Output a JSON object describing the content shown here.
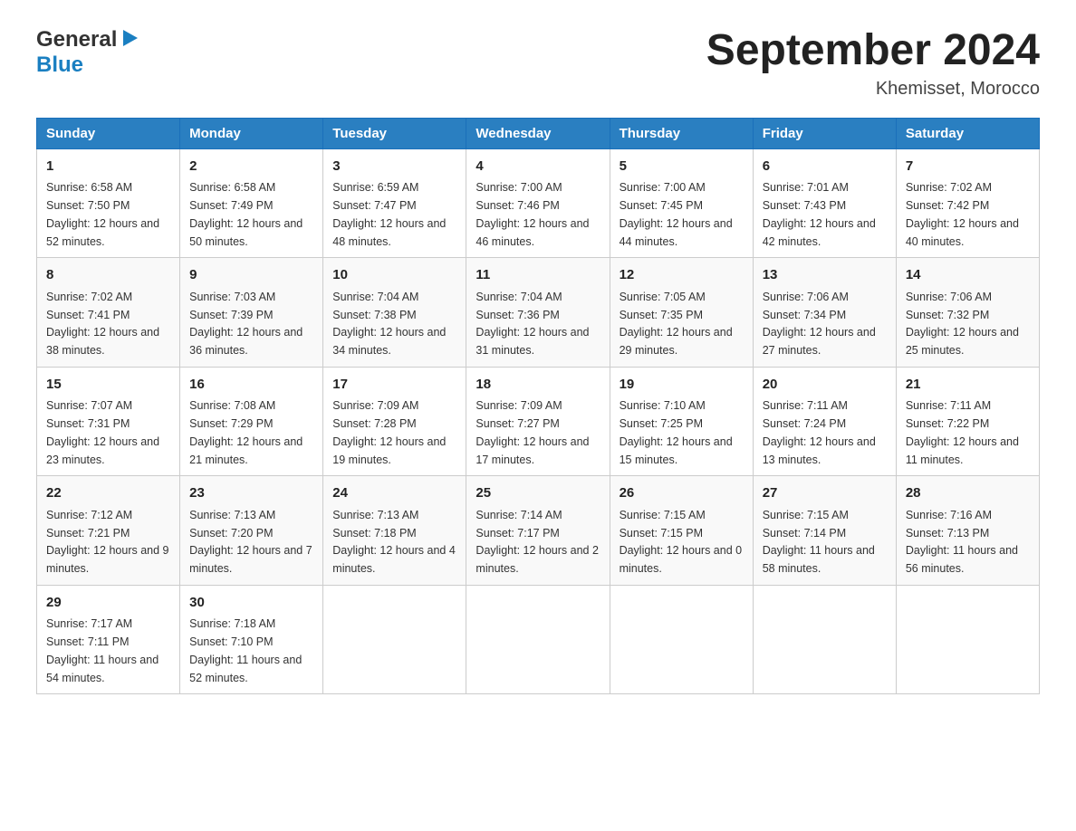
{
  "header": {
    "logo_general": "General",
    "logo_blue": "Blue",
    "month_year": "September 2024",
    "location": "Khemisset, Morocco"
  },
  "days_of_week": [
    "Sunday",
    "Monday",
    "Tuesday",
    "Wednesday",
    "Thursday",
    "Friday",
    "Saturday"
  ],
  "weeks": [
    [
      {
        "day": "1",
        "sunrise": "6:58 AM",
        "sunset": "7:50 PM",
        "daylight": "12 hours and 52 minutes."
      },
      {
        "day": "2",
        "sunrise": "6:58 AM",
        "sunset": "7:49 PM",
        "daylight": "12 hours and 50 minutes."
      },
      {
        "day": "3",
        "sunrise": "6:59 AM",
        "sunset": "7:47 PM",
        "daylight": "12 hours and 48 minutes."
      },
      {
        "day": "4",
        "sunrise": "7:00 AM",
        "sunset": "7:46 PM",
        "daylight": "12 hours and 46 minutes."
      },
      {
        "day": "5",
        "sunrise": "7:00 AM",
        "sunset": "7:45 PM",
        "daylight": "12 hours and 44 minutes."
      },
      {
        "day": "6",
        "sunrise": "7:01 AM",
        "sunset": "7:43 PM",
        "daylight": "12 hours and 42 minutes."
      },
      {
        "day": "7",
        "sunrise": "7:02 AM",
        "sunset": "7:42 PM",
        "daylight": "12 hours and 40 minutes."
      }
    ],
    [
      {
        "day": "8",
        "sunrise": "7:02 AM",
        "sunset": "7:41 PM",
        "daylight": "12 hours and 38 minutes."
      },
      {
        "day": "9",
        "sunrise": "7:03 AM",
        "sunset": "7:39 PM",
        "daylight": "12 hours and 36 minutes."
      },
      {
        "day": "10",
        "sunrise": "7:04 AM",
        "sunset": "7:38 PM",
        "daylight": "12 hours and 34 minutes."
      },
      {
        "day": "11",
        "sunrise": "7:04 AM",
        "sunset": "7:36 PM",
        "daylight": "12 hours and 31 minutes."
      },
      {
        "day": "12",
        "sunrise": "7:05 AM",
        "sunset": "7:35 PM",
        "daylight": "12 hours and 29 minutes."
      },
      {
        "day": "13",
        "sunrise": "7:06 AM",
        "sunset": "7:34 PM",
        "daylight": "12 hours and 27 minutes."
      },
      {
        "day": "14",
        "sunrise": "7:06 AM",
        "sunset": "7:32 PM",
        "daylight": "12 hours and 25 minutes."
      }
    ],
    [
      {
        "day": "15",
        "sunrise": "7:07 AM",
        "sunset": "7:31 PM",
        "daylight": "12 hours and 23 minutes."
      },
      {
        "day": "16",
        "sunrise": "7:08 AM",
        "sunset": "7:29 PM",
        "daylight": "12 hours and 21 minutes."
      },
      {
        "day": "17",
        "sunrise": "7:09 AM",
        "sunset": "7:28 PM",
        "daylight": "12 hours and 19 minutes."
      },
      {
        "day": "18",
        "sunrise": "7:09 AM",
        "sunset": "7:27 PM",
        "daylight": "12 hours and 17 minutes."
      },
      {
        "day": "19",
        "sunrise": "7:10 AM",
        "sunset": "7:25 PM",
        "daylight": "12 hours and 15 minutes."
      },
      {
        "day": "20",
        "sunrise": "7:11 AM",
        "sunset": "7:24 PM",
        "daylight": "12 hours and 13 minutes."
      },
      {
        "day": "21",
        "sunrise": "7:11 AM",
        "sunset": "7:22 PM",
        "daylight": "12 hours and 11 minutes."
      }
    ],
    [
      {
        "day": "22",
        "sunrise": "7:12 AM",
        "sunset": "7:21 PM",
        "daylight": "12 hours and 9 minutes."
      },
      {
        "day": "23",
        "sunrise": "7:13 AM",
        "sunset": "7:20 PM",
        "daylight": "12 hours and 7 minutes."
      },
      {
        "day": "24",
        "sunrise": "7:13 AM",
        "sunset": "7:18 PM",
        "daylight": "12 hours and 4 minutes."
      },
      {
        "day": "25",
        "sunrise": "7:14 AM",
        "sunset": "7:17 PM",
        "daylight": "12 hours and 2 minutes."
      },
      {
        "day": "26",
        "sunrise": "7:15 AM",
        "sunset": "7:15 PM",
        "daylight": "12 hours and 0 minutes."
      },
      {
        "day": "27",
        "sunrise": "7:15 AM",
        "sunset": "7:14 PM",
        "daylight": "11 hours and 58 minutes."
      },
      {
        "day": "28",
        "sunrise": "7:16 AM",
        "sunset": "7:13 PM",
        "daylight": "11 hours and 56 minutes."
      }
    ],
    [
      {
        "day": "29",
        "sunrise": "7:17 AM",
        "sunset": "7:11 PM",
        "daylight": "11 hours and 54 minutes."
      },
      {
        "day": "30",
        "sunrise": "7:18 AM",
        "sunset": "7:10 PM",
        "daylight": "11 hours and 52 minutes."
      },
      null,
      null,
      null,
      null,
      null
    ]
  ]
}
